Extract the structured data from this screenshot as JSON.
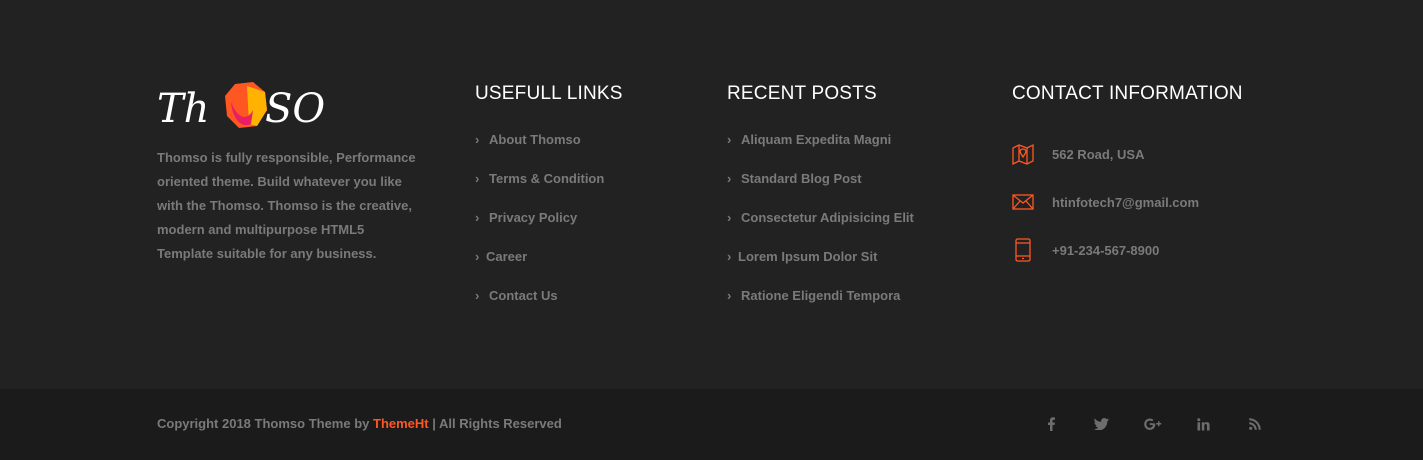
{
  "brand": {
    "logo_text_left": "Th",
    "logo_text_right": "SO",
    "about": "Thomso is fully responsible, Performance oriented theme. Build whatever you like with the Thomso. Thomso is the creative, modern and multipurpose HTML5 Template suitable for any business."
  },
  "useful_links": {
    "heading": "USEFULL LINKS",
    "items": [
      {
        "label": "About Thomso"
      },
      {
        "label": "Terms & Condition"
      },
      {
        "label": "Privacy Policy"
      },
      {
        "label": "Career"
      },
      {
        "label": "Contact Us"
      }
    ]
  },
  "recent_posts": {
    "heading": "RECENT POSTS",
    "items": [
      {
        "label": "Aliquam Expedita Magni"
      },
      {
        "label": "Standard Blog Post"
      },
      {
        "label": "Consectetur Adipisicing Elit"
      },
      {
        "label": "Lorem Ipsum Dolor Sit"
      },
      {
        "label": "Ratione Eligendi Tempora"
      }
    ]
  },
  "contact": {
    "heading": "CONTACT INFORMATION",
    "items": [
      {
        "icon": "map-icon",
        "text": "562 Road, USA"
      },
      {
        "icon": "envelope-icon",
        "text": "htinfotech7@gmail.com"
      },
      {
        "icon": "phone-icon",
        "text": "+91-234-567-8900"
      }
    ]
  },
  "bottom": {
    "copyright_prefix": "Copyright 2018 Thomso Theme by ",
    "copyright_brand": "ThemeHt",
    "copyright_suffix": " | All Rights Reserved",
    "social": [
      {
        "icon": "facebook-icon",
        "glyph": "f"
      },
      {
        "icon": "twitter-icon",
        "glyph": "t"
      },
      {
        "icon": "google-plus-icon",
        "glyph": "G+"
      },
      {
        "icon": "linkedin-icon",
        "glyph": "in"
      },
      {
        "icon": "rss-icon",
        "glyph": "rss"
      }
    ]
  },
  "colors": {
    "background": "#222222",
    "bottom_bar": "#1b1b1b",
    "accent": "#ff5722",
    "text_muted": "#7a7a7a",
    "heading": "#ffffff"
  }
}
